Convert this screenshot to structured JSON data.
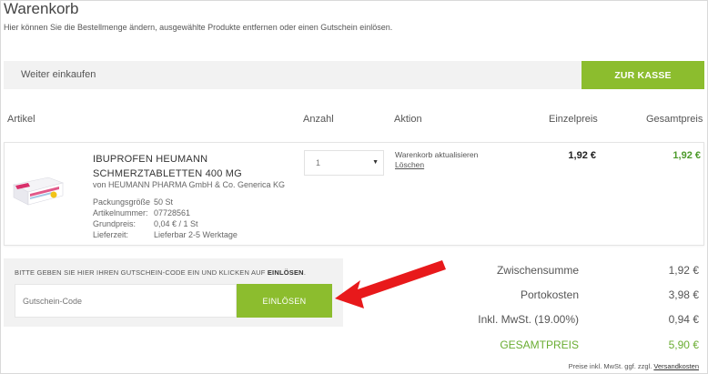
{
  "page": {
    "title": "Warenkorb",
    "subtitle": "Hier können Sie die Bestellmenge ändern, ausgewählte Produkte entfernen oder einen Gutschein einlösen."
  },
  "top_bar": {
    "continue_label": "Weiter einkaufen",
    "checkout_label": "ZUR KASSE"
  },
  "columns": {
    "article": "Artikel",
    "quantity": "Anzahl",
    "action": "Aktion",
    "unit_price": "Einzelpreis",
    "total_price": "Gesamtpreis"
  },
  "item": {
    "name_line1": "IBUPROFEN HEUMANN",
    "name_line2": "SCHMERZTABLETTEN 400 MG",
    "maker": "von HEUMANN PHARMA GmbH & Co. Generica KG",
    "specs": [
      {
        "label": "Packungsgröße",
        "value": "50 St"
      },
      {
        "label": "Artikelnummer:",
        "value": "07728561"
      },
      {
        "label": "Grundpreis:",
        "value": "0,04 € / 1 St"
      },
      {
        "label": "Lieferzeit:",
        "value": "Lieferbar 2-5 Werktage"
      }
    ],
    "quantity": "1",
    "update_label": "Warenkorb aktualisieren",
    "delete_label": "Löschen",
    "unit_price": "1,92 €",
    "total_price": "1,92 €",
    "image_icon": "medicine-box-image"
  },
  "voucher": {
    "text_prefix": "BITTE GEBEN SIE HIER IHREN GUTSCHEIN-CODE EIN UND KLICKEN AUF ",
    "text_bold": "EINLÖSEN",
    "text_suffix": ".",
    "placeholder": "Gutschein-Code",
    "button_label": "EINLÖSEN"
  },
  "annotation": {
    "icon": "red-arrow-icon",
    "color": "#e8191b"
  },
  "summary": {
    "subtotal_label": "Zwischensumme",
    "subtotal_value": "1,92 €",
    "shipping_label": "Portokosten",
    "shipping_value": "3,98 €",
    "tax_label": "Inkl. MwSt. (19.00%)",
    "tax_value": "0,94 €",
    "grand_label": "GESAMTPREIS",
    "grand_value": "5,90 €"
  },
  "footer": {
    "note_prefix": "Preise inkl. MwSt. ggf. zzgl. ",
    "shipping_link": "Versandkosten"
  },
  "colors": {
    "accent_green": "#8cbd2e",
    "price_green": "#4c9a2a",
    "panel_gray": "#f2f2f2"
  }
}
